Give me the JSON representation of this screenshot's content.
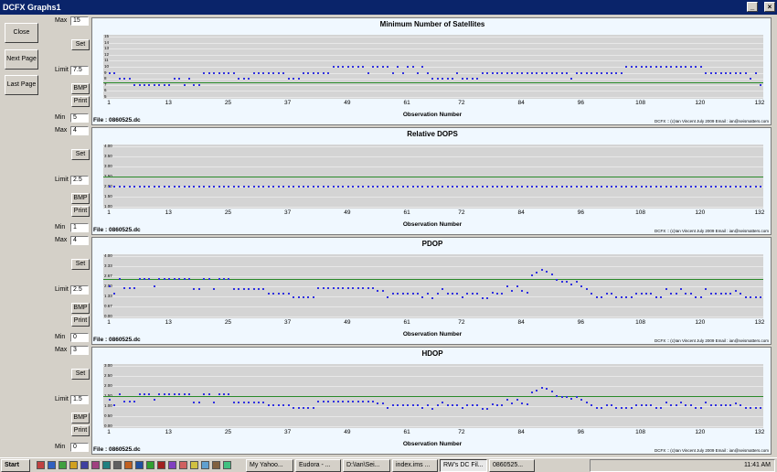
{
  "window": {
    "title": "DCFX Graphs1"
  },
  "left_buttons": {
    "close": "Close",
    "next_page": "Next Page",
    "last_page": "Last Page"
  },
  "controls": {
    "max_label": "Max",
    "min_label": "Min",
    "limit_label": "Limit",
    "set": "Set",
    "bmp": "BMP",
    "print": "Print"
  },
  "graphs": [
    {
      "title": "Minimum Number of Satellites",
      "max": "15",
      "min": "5",
      "limit": "7.5",
      "yticks": [
        "15",
        "14",
        "13",
        "12",
        "11",
        "10",
        "9",
        "8",
        "7",
        "6",
        "5"
      ],
      "ymin": 5,
      "ymax": 15,
      "limit_value": 7.5,
      "file": "File :  0860525.dc"
    },
    {
      "title": "Relative DOPS",
      "max": "4",
      "min": "1",
      "limit": "2.5",
      "yticks": [
        "4.00",
        "3.50",
        "3.00",
        "2.50",
        "2.00",
        "1.50",
        "1.00"
      ],
      "ymin": 1,
      "ymax": 4,
      "limit_value": 2.5,
      "file": "File :  0860525.dc"
    },
    {
      "title": "PDOP",
      "max": "4",
      "min": "0",
      "limit": "2.5",
      "yticks": [
        "4.00",
        "3.33",
        "2.67",
        "2.00",
        "1.33",
        "0.67",
        "0.00"
      ],
      "ymin": 0,
      "ymax": 4,
      "limit_value": 2.5,
      "file": "File :  0860525.dc"
    },
    {
      "title": "HDOP",
      "max": "3",
      "min": "0",
      "limit": "1.5",
      "yticks": [
        "3.00",
        "2.50",
        "2.00",
        "1.50",
        "1.00",
        "0.50",
        "0.00"
      ],
      "ymin": 0,
      "ymax": 3,
      "limit_value": 1.5,
      "file": "File :  0860525.dc"
    }
  ],
  "xaxis": {
    "label": "Observation Number",
    "ticks": [
      "1",
      "13",
      "25",
      "37",
      "49",
      "61",
      "72",
      "84",
      "96",
      "108",
      "120",
      "132"
    ]
  },
  "credit": "DCFX :: (c)Ian Vincent July 2009 Email : ian@seismatters.com",
  "chart_data": [
    {
      "type": "scatter",
      "title": "Minimum Number of Satellites",
      "xlabel": "Observation Number",
      "ylim": [
        5,
        15
      ],
      "x_range": [
        1,
        132
      ],
      "limit": 7.5,
      "series": [
        {
          "values": [
            9,
            9,
            8,
            8,
            8,
            7,
            7,
            7,
            7,
            7,
            7,
            7,
            7,
            7,
            7,
            8,
            8,
            7,
            8,
            7,
            7,
            9,
            9,
            9,
            9,
            9,
            9,
            9,
            9,
            8,
            8,
            8,
            9,
            9,
            9,
            9,
            9,
            9,
            9,
            9,
            8,
            8,
            8,
            8,
            9,
            9,
            9,
            9,
            9,
            9,
            10,
            10,
            10,
            10,
            10,
            10,
            10,
            10,
            9,
            10,
            9,
            10,
            10,
            10,
            9,
            10,
            9,
            10,
            10,
            10,
            9,
            10,
            9,
            8,
            8,
            8,
            8,
            8,
            9,
            9,
            8,
            8,
            8,
            8,
            9,
            9,
            9,
            9,
            9,
            9,
            9,
            9,
            9,
            9,
            9,
            9,
            9,
            9,
            9,
            9,
            9,
            9,
            9,
            9,
            8,
            9,
            9,
            9,
            9,
            9,
            9,
            9,
            9,
            9,
            9,
            9,
            10,
            10,
            10,
            10,
            10,
            10,
            10,
            10,
            10,
            10,
            10,
            10,
            10,
            10,
            10,
            10,
            10,
            10,
            9,
            9,
            9,
            9,
            9,
            9,
            9,
            9,
            9,
            9,
            9,
            8,
            9,
            7
          ]
        }
      ]
    },
    {
      "type": "scatter",
      "title": "Relative DOPS",
      "xlabel": "Observation Number",
      "ylim": [
        1,
        4
      ],
      "x_range": [
        1,
        132
      ],
      "limit": 2.5,
      "series": [
        {
          "values": "all 2.00"
        }
      ]
    },
    {
      "type": "scatter",
      "title": "PDOP",
      "xlabel": "Observation Number",
      "ylim": [
        0,
        4
      ],
      "x_range": [
        1,
        132
      ],
      "limit": 2.5
    },
    {
      "type": "scatter",
      "title": "HDOP",
      "xlabel": "Observation Number",
      "ylim": [
        0,
        3
      ],
      "x_range": [
        1,
        132
      ],
      "limit": 1.5
    }
  ],
  "taskbar": {
    "start": "Start",
    "clock": "11:41 AM",
    "tasks": [
      "My Yahoo...",
      "Eudora - ...",
      "D:\\Ian\\Sei...",
      "index.ims ...",
      "RW's DC Fil...",
      "0860525..."
    ]
  }
}
